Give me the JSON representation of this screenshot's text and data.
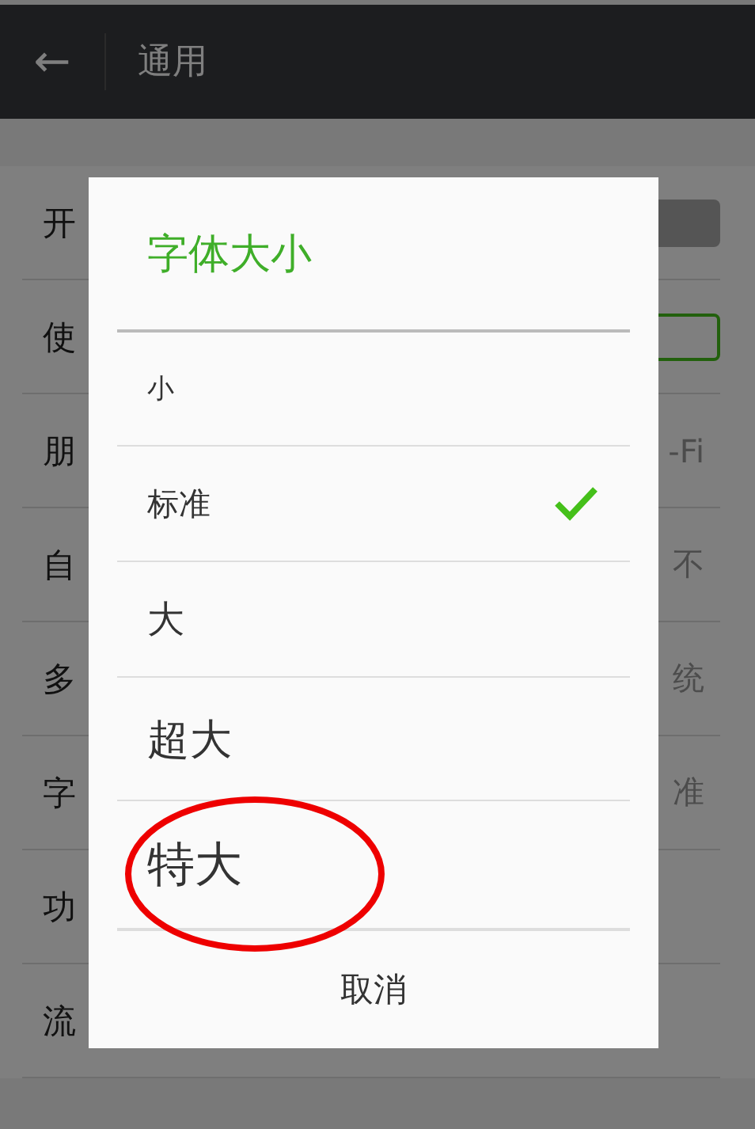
{
  "header": {
    "back_glyph": "←",
    "title": "通用"
  },
  "settings": [
    {
      "label": "开",
      "kind": "toggle",
      "on": false
    },
    {
      "label": "使",
      "kind": "toggle",
      "on": true
    },
    {
      "label": "朋",
      "kind": "value",
      "value": "-Fi"
    },
    {
      "label": "自",
      "kind": "value",
      "value": "不"
    },
    {
      "label": "多",
      "kind": "value",
      "value": "统"
    },
    {
      "label": "字",
      "kind": "value",
      "value": "准"
    },
    {
      "label": "功",
      "kind": "plain"
    },
    {
      "label": "流",
      "kind": "plain"
    }
  ],
  "dialog": {
    "title": "字体大小",
    "options": [
      {
        "label": "小",
        "selected": false,
        "highlighted": false
      },
      {
        "label": "标准",
        "selected": true,
        "highlighted": false
      },
      {
        "label": "大",
        "selected": false,
        "highlighted": false
      },
      {
        "label": "超大",
        "selected": false,
        "highlighted": false
      },
      {
        "label": "特大",
        "selected": false,
        "highlighted": true
      }
    ],
    "cancel": "取消"
  }
}
